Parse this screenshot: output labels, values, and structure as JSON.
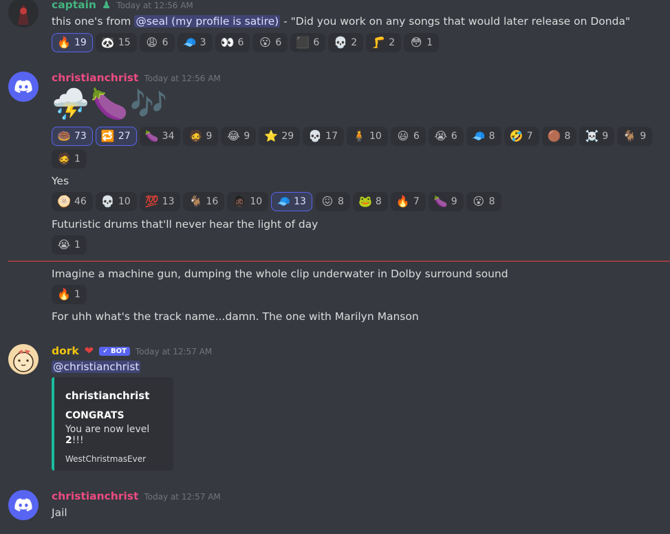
{
  "colors": {
    "background": "#36393f",
    "blurple": "#5865f2",
    "new_divider": "#ed4245",
    "embed_accent": "#1abc9c"
  },
  "messages": [
    {
      "author": "captain",
      "author_color": "#43b581",
      "badge_icon": "green-person-icon",
      "timestamp": "Today at 12:56 AM",
      "text_before": "this one's from",
      "mention": "@seal (my profile is satire)",
      "text_after": " - \"Did you work on any songs that would later release on Donda\"",
      "reactions": [
        {
          "emoji": "🔥",
          "icon": "fire-icon",
          "count": "19",
          "me": true
        },
        {
          "emoji": "🐼",
          "icon": "panda-icon",
          "count": "15",
          "me": false
        },
        {
          "emoji": "😩",
          "icon": "weary-face-icon",
          "count": "6",
          "me": false
        },
        {
          "emoji": "🧢",
          "icon": "cap-icon",
          "count": "3",
          "me": false
        },
        {
          "emoji": "👀",
          "icon": "eyes-icon",
          "count": "6",
          "me": false
        },
        {
          "emoji": "😮",
          "icon": "surprised-face-icon",
          "count": "6",
          "me": false
        },
        {
          "emoji": "⬛",
          "icon": "black-square-icon",
          "count": "6",
          "me": false
        },
        {
          "emoji": "💀",
          "icon": "skull-icon",
          "count": "2",
          "me": false
        },
        {
          "emoji": "🦵",
          "icon": "leg-icon",
          "count": "2",
          "me": false
        },
        {
          "emoji": "😳",
          "icon": "flushed-face-icon",
          "count": "1",
          "me": false
        }
      ]
    },
    {
      "author": "christianchrist",
      "author_color": "#ed4b82",
      "timestamp": "Today at 12:56 AM",
      "big_emojis": [
        {
          "emoji": "⛈️",
          "icon": "thunder-cloud-icon"
        },
        {
          "emoji": "🍆",
          "icon": "eggplant-icon"
        },
        {
          "emoji": "🎶",
          "icon": "music-notes-icon"
        }
      ],
      "reactions_row1": [
        {
          "emoji": "🍩",
          "icon": "ring-icon",
          "count": "73",
          "me": true
        },
        {
          "emoji": "🔁",
          "icon": "repeat-icon",
          "count": "27",
          "me": true
        },
        {
          "emoji": "🍆",
          "icon": "eggplant-icon",
          "count": "34",
          "me": false
        },
        {
          "emoji": "🧔",
          "icon": "man-face-icon",
          "count": "9",
          "me": false
        },
        {
          "emoji": "😂",
          "icon": "joy-face-icon",
          "count": "9",
          "me": false
        },
        {
          "emoji": "⭐",
          "icon": "star-icon",
          "count": "29",
          "me": false
        },
        {
          "emoji": "💀",
          "icon": "skull-icon",
          "count": "17",
          "me": false
        },
        {
          "emoji": "🧍",
          "icon": "person-photo-icon",
          "count": "10",
          "me": false
        },
        {
          "emoji": "😃",
          "icon": "smile-face-icon",
          "count": "6",
          "me": false
        },
        {
          "emoji": "😭",
          "icon": "crying-face-icon",
          "count": "6",
          "me": false
        },
        {
          "emoji": "🧢",
          "icon": "cap-icon",
          "count": "8",
          "me": false
        },
        {
          "emoji": "🤣",
          "icon": "rofl-face-icon",
          "count": "7",
          "me": false
        },
        {
          "emoji": "🟤",
          "icon": "brown-circle-icon",
          "count": "8",
          "me": false
        },
        {
          "emoji": "☠️",
          "icon": "skull-crossbones-icon",
          "count": "9",
          "me": false
        },
        {
          "emoji": "🐐",
          "icon": "goat-icon",
          "count": "9",
          "me": false
        }
      ],
      "reactions_row2": [
        {
          "emoji": "🧔",
          "icon": "man-face-icon",
          "count": "1",
          "me": false
        }
      ],
      "followups": [
        {
          "text": "Yes",
          "reactions": [
            {
              "emoji": "🫓",
              "icon": "sandwich-icon",
              "count": "46",
              "me": false
            },
            {
              "emoji": "💀",
              "icon": "skull-icon",
              "count": "10",
              "me": false
            },
            {
              "emoji": "💯",
              "icon": "hundred-icon",
              "count": "13",
              "me": false
            },
            {
              "emoji": "🐐",
              "icon": "goat-icon",
              "count": "16",
              "me": false
            },
            {
              "emoji": "🧔🏿",
              "icon": "dark-face-icon",
              "count": "10",
              "me": false
            },
            {
              "emoji": "🧢",
              "icon": "cap-icon",
              "count": "13",
              "me": true
            },
            {
              "emoji": "😖",
              "icon": "pink-face-icon",
              "count": "8",
              "me": false
            },
            {
              "emoji": "🐸",
              "icon": "frog-icon",
              "count": "8",
              "me": false
            },
            {
              "emoji": "🔥",
              "icon": "fire-icon",
              "count": "7",
              "me": false
            },
            {
              "emoji": "🍆",
              "icon": "eggplant-icon",
              "count": "9",
              "me": false
            },
            {
              "emoji": "😮",
              "icon": "surprised-face-icon",
              "count": "8",
              "me": false
            }
          ]
        },
        {
          "text": "Futuristic drums that'll never hear the light of day",
          "reactions": [
            {
              "emoji": "😭",
              "icon": "crying-face-icon",
              "count": "1",
              "me": false
            }
          ]
        },
        {
          "text": "Imagine a machine gun, dumping the whole clip underwater in Dolby surround sound",
          "reactions": [
            {
              "emoji": "🔥",
              "icon": "fire-icon",
              "count": "1",
              "me": false
            }
          ]
        },
        {
          "text": "For uhh what's the track name...damn. The one with Marilyn Manson",
          "reactions": []
        }
      ]
    },
    {
      "author": "dork",
      "author_color": "#f1c40f",
      "badge_icon": "heart-icon",
      "bot_tag": "✓ BOT",
      "timestamp": "Today at 12:57 AM",
      "mention": "@christianchrist",
      "embed": {
        "author": "christianchrist",
        "title": "CONGRATS",
        "desc_before": "You are now level ",
        "level": "2",
        "desc_after": "!!!",
        "footer": "WestChristmasEver"
      }
    },
    {
      "author": "christianchrist",
      "author_color": "#ed4b82",
      "timestamp": "Today at 12:57 AM",
      "text": "Jail"
    }
  ]
}
